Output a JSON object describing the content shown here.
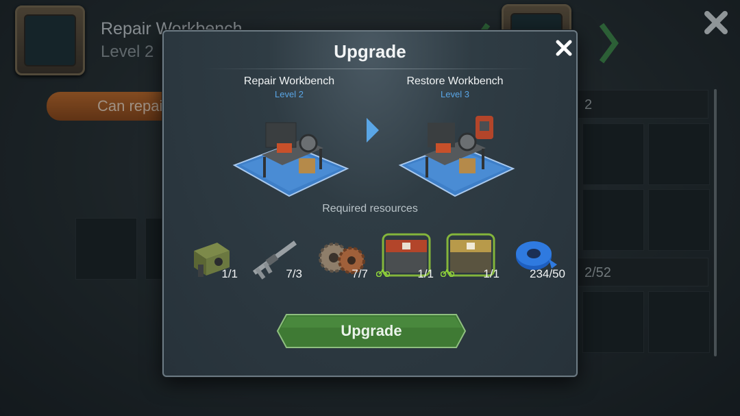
{
  "background": {
    "title": "Repair Workbench",
    "level": "Level 2",
    "repair_tab": "Can repair",
    "counter_top": "2",
    "counter_bottom": "2/52"
  },
  "dialog": {
    "title": "Upgrade",
    "from": {
      "name": "Repair Workbench",
      "level": "Level 2"
    },
    "to": {
      "name": "Restore Workbench",
      "level": "Level 3"
    },
    "required_label": "Required resources",
    "resources": [
      {
        "icon": "generator-icon",
        "count": "1/1"
      },
      {
        "icon": "caliper-icon",
        "count": "7/3"
      },
      {
        "icon": "gears-icon",
        "count": "7/7"
      },
      {
        "icon": "red-crate-icon",
        "count": "1/1",
        "bike": true
      },
      {
        "icon": "yellow-crate-icon",
        "count": "1/1",
        "bike": true
      },
      {
        "icon": "tape-icon",
        "count": "234/50"
      }
    ],
    "button_label": "Upgrade"
  },
  "colors": {
    "accent_blue": "#5aa6e6",
    "button_green": "#3f7a34",
    "bike_green": "#8fd43a",
    "repair_orange": "#c56d2a"
  }
}
